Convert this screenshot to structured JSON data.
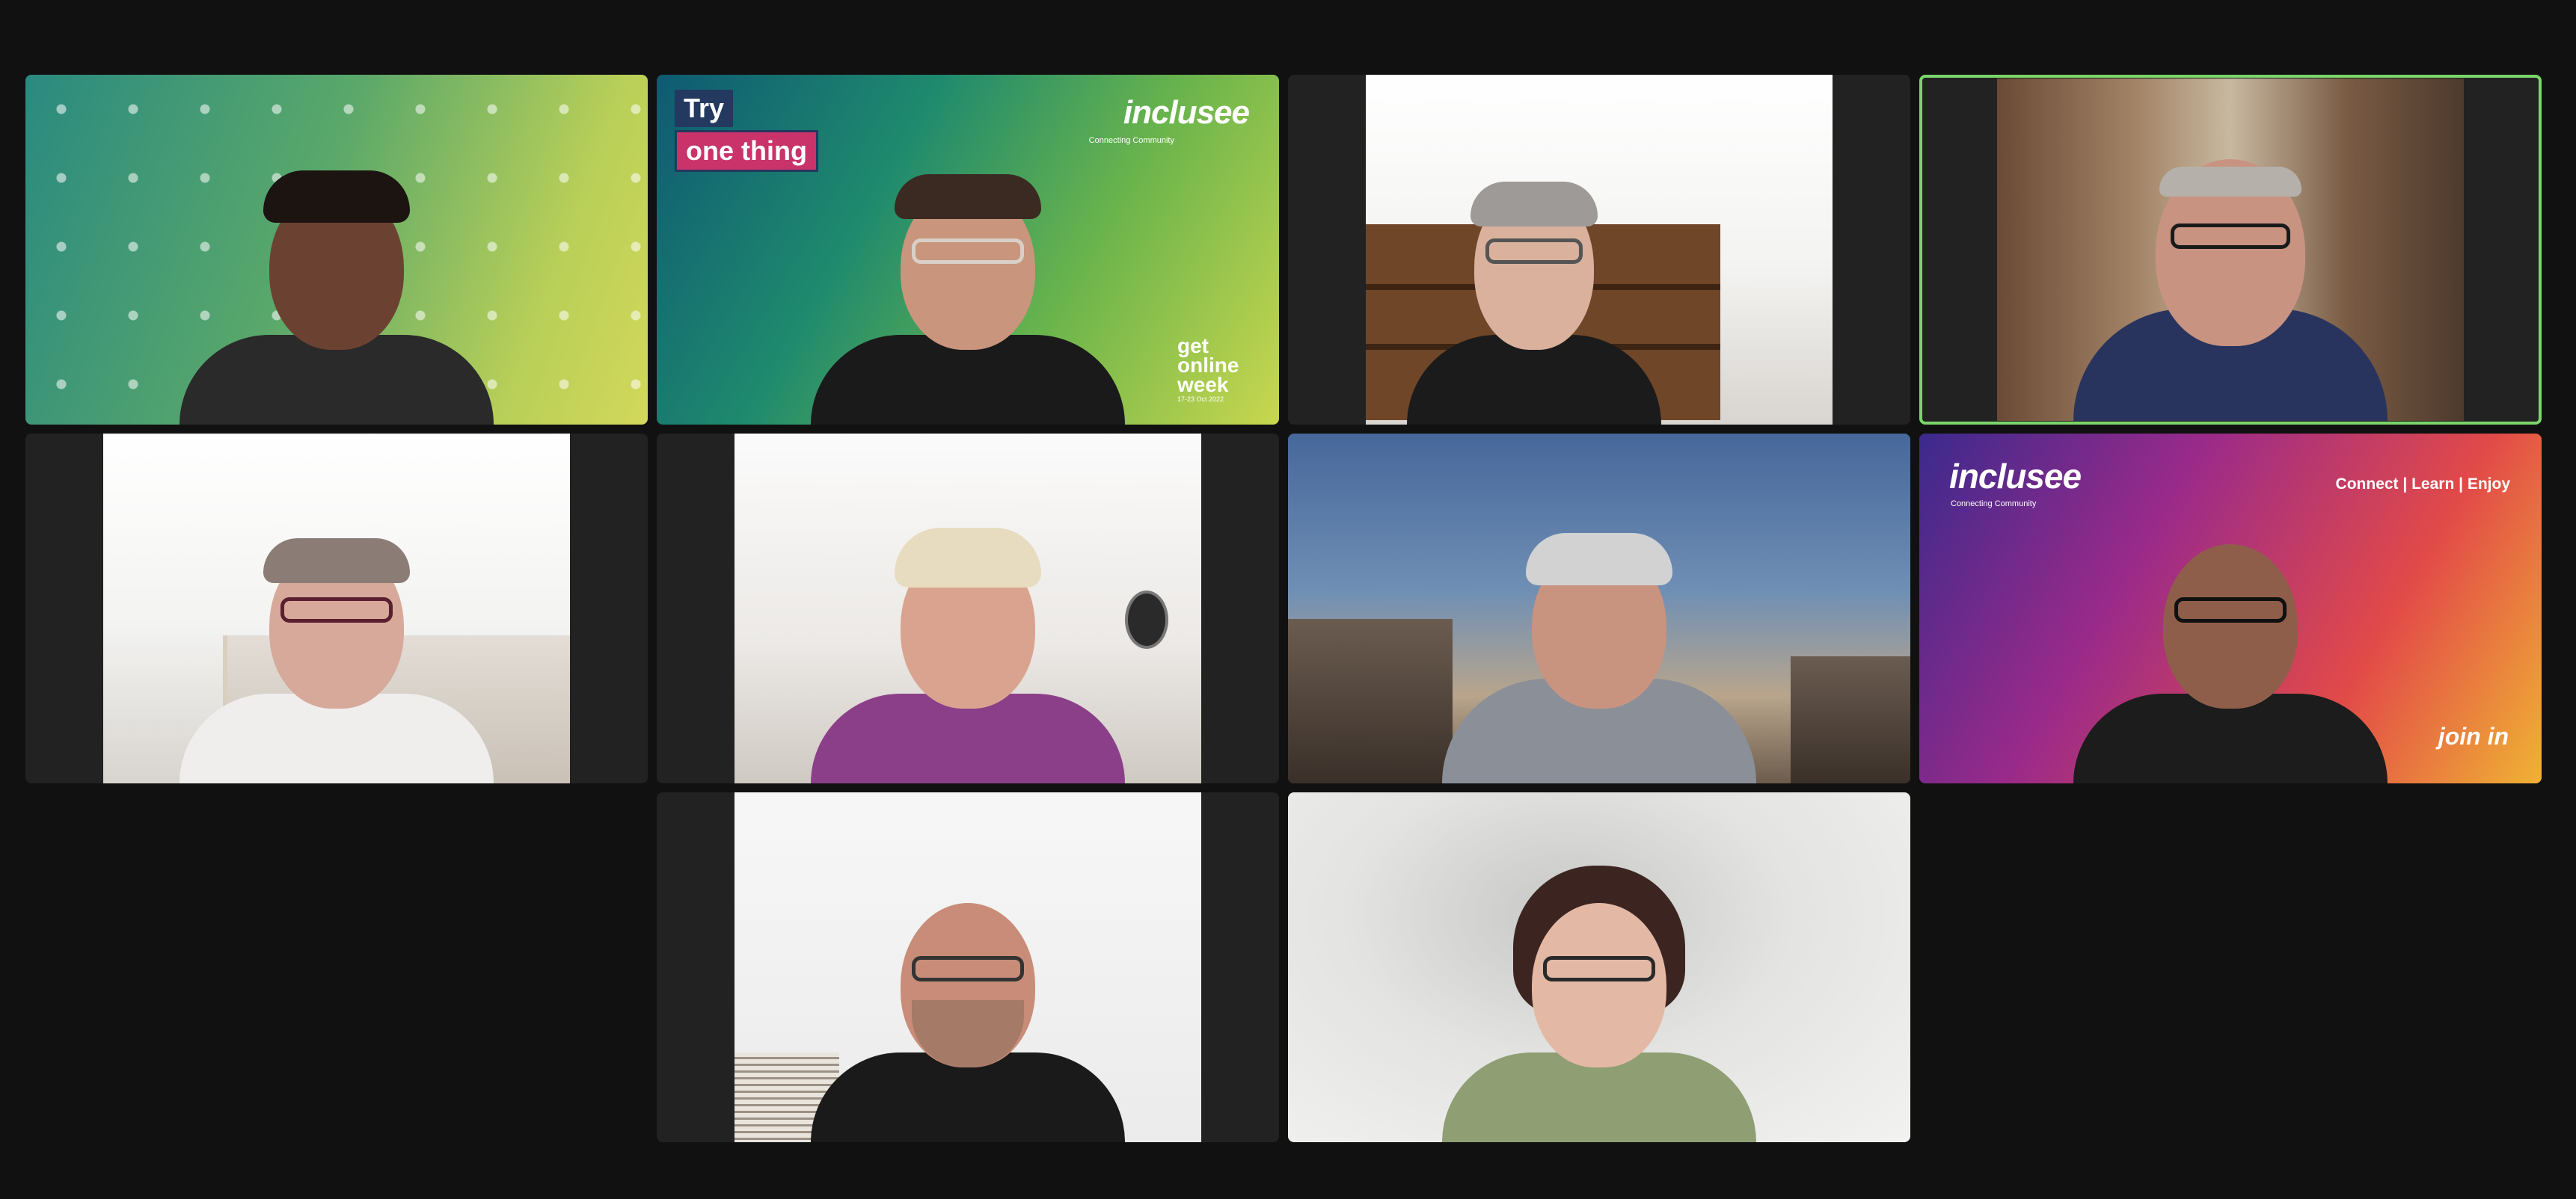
{
  "meeting": {
    "tiles": [
      {
        "id": "p1",
        "background": "pattern",
        "active": false,
        "skin": "#6b4232",
        "hair": "#1b1411",
        "shirt": "#2a2a2a",
        "glasses": false
      },
      {
        "id": "p2",
        "background": "green-brand",
        "active": false,
        "skin": "#c9957c",
        "hair": "#3a2a22",
        "shirt": "#1a1a1a",
        "glasses": true,
        "overlay": {
          "try": "Try",
          "one_thing": "one thing",
          "brand": "inclusee",
          "brand_sub": "Connecting Community",
          "gow_line1": "get",
          "gow_line2": "online",
          "gow_line3": "week",
          "gow_dates": "17-23 Oct 2022"
        }
      },
      {
        "id": "p3",
        "background": "room-shelves",
        "active": false,
        "skin": "#d9b19c",
        "hair": "#9e9a98",
        "shirt": "#1b1b1b",
        "glasses": true
      },
      {
        "id": "p4",
        "background": "curtain",
        "active": true,
        "skin": "#c99381",
        "hair": "#b5b0aa",
        "shirt": "#28345d",
        "glasses": true
      },
      {
        "id": "p5",
        "background": "room-light",
        "active": false,
        "skin": "#d7a99a",
        "hair": "#8c7c76",
        "shirt": "#f0eded",
        "glasses": true
      },
      {
        "id": "p6",
        "background": "lounge",
        "active": false,
        "skin": "#d9a38f",
        "hair": "#e8dcc0",
        "shirt": "#8c3f89",
        "glasses": false
      },
      {
        "id": "p7",
        "background": "sky",
        "active": false,
        "skin": "#c89480",
        "hair": "#d2d2d2",
        "shirt": "#8b8f98",
        "glasses": false
      },
      {
        "id": "p8",
        "background": "magenta-brand",
        "active": false,
        "skin": "#8f5e4a",
        "hair": "#5a3a30",
        "shirt": "#1c1c1c",
        "glasses": true,
        "overlay": {
          "brand": "inclusee",
          "brand_sub": "Connecting Community",
          "tagline": "Connect | Learn | Enjoy",
          "joinin": "join in"
        }
      },
      {
        "id": "p9",
        "background": "white-room",
        "active": false,
        "skin": "#c98c78",
        "hair": "#b89a88",
        "shirt": "#1a1a1a",
        "glasses": true
      },
      {
        "id": "p10",
        "background": "blur",
        "active": false,
        "skin": "#e3b9a5",
        "hair": "#3c2521",
        "shirt": "#8f9e73",
        "glasses": true
      }
    ]
  }
}
